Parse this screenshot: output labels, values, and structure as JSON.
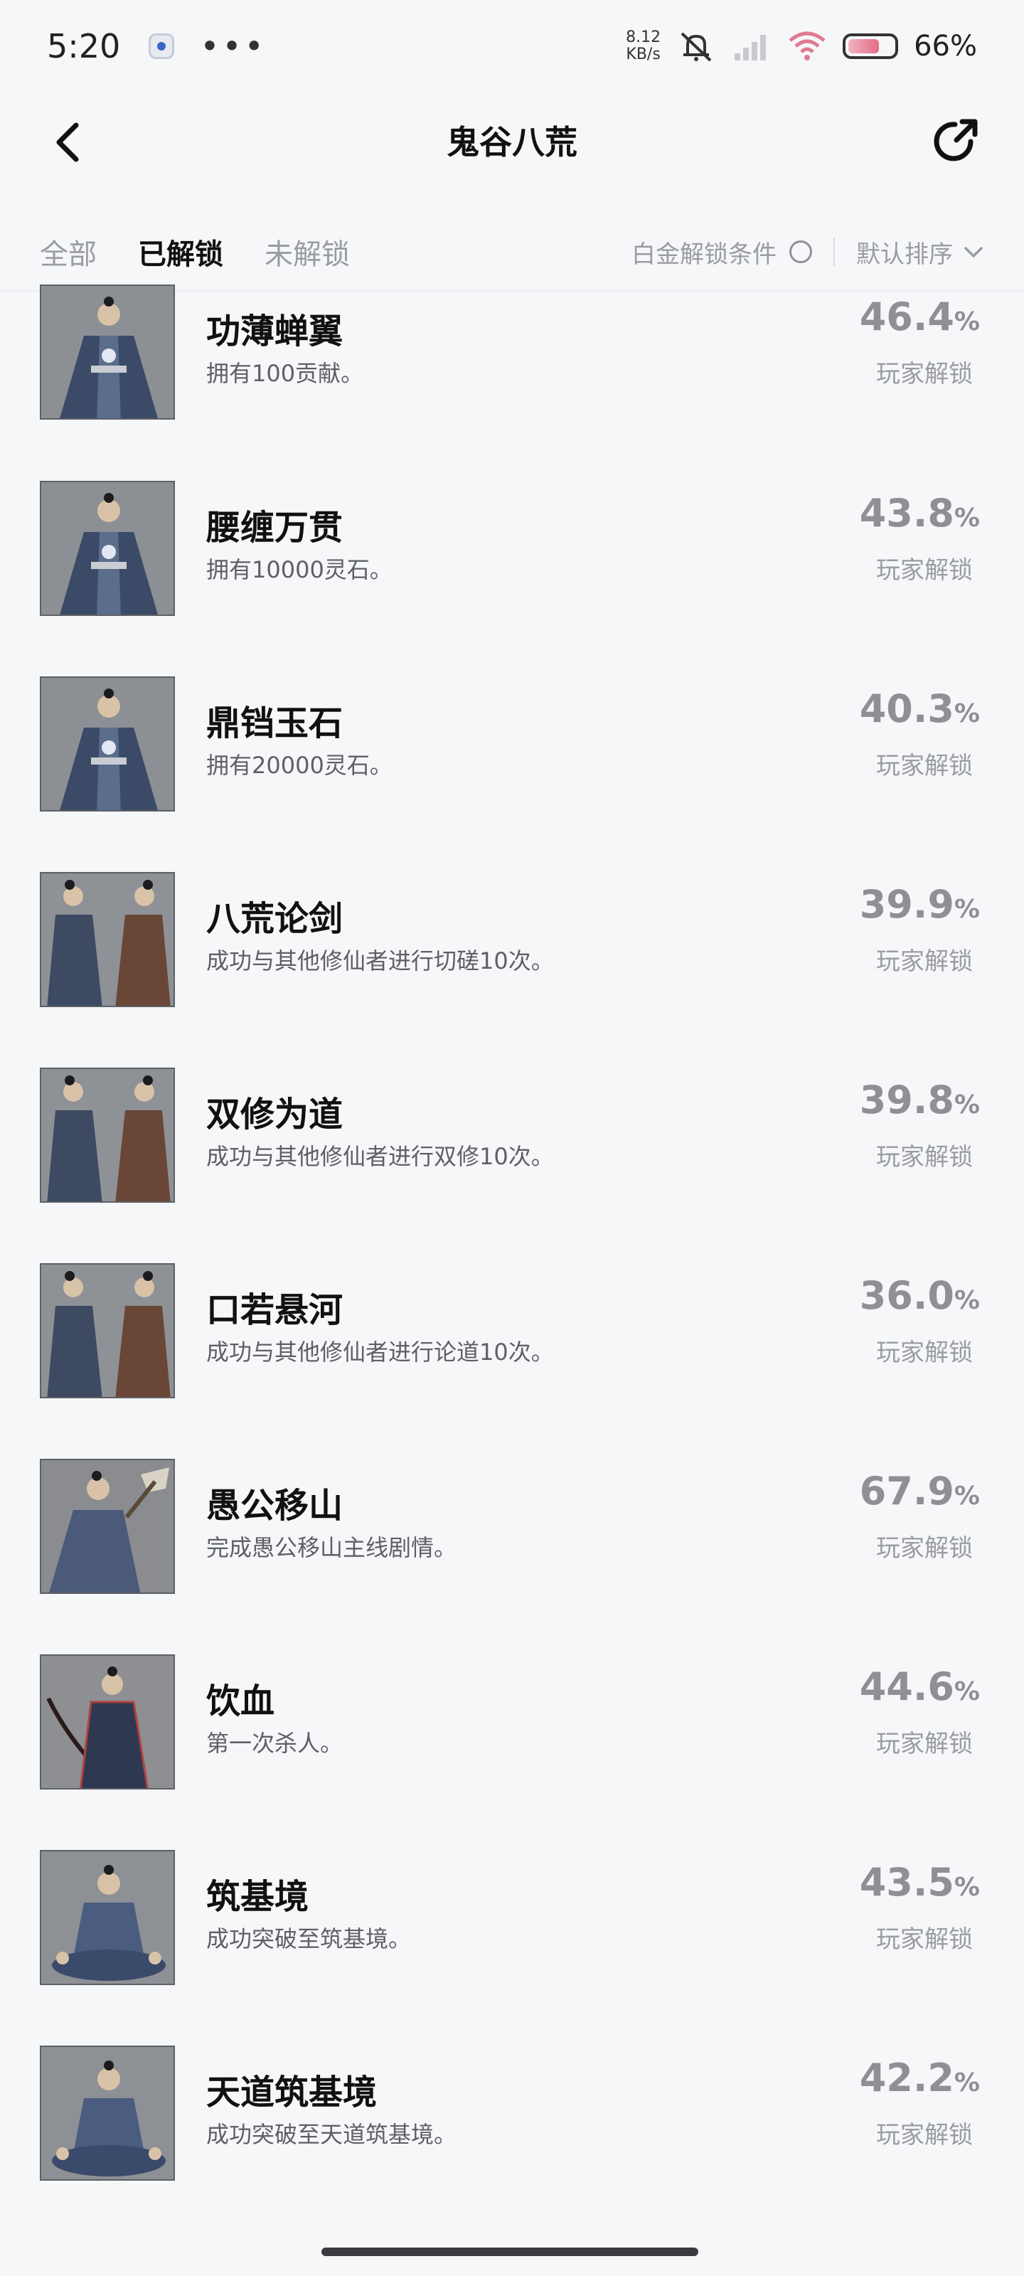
{
  "status_bar": {
    "time": "5:20",
    "dots": "•••",
    "net_speed_value": "8.12",
    "net_speed_unit": "KB/s",
    "battery": "66%"
  },
  "header": {
    "title": "鬼谷八荒"
  },
  "tabs": [
    {
      "label": "全部"
    },
    {
      "label": "已解锁"
    },
    {
      "label": "未解锁"
    }
  ],
  "filters": {
    "platinum": "白金解锁条件",
    "sort": "默认排序"
  },
  "achievements": [
    {
      "title": "功薄蝉翼",
      "desc": "拥有100贡献。",
      "rate": "46.4",
      "pct": "%",
      "unlock": "玩家解锁",
      "icon": "robed-figure-icon"
    },
    {
      "title": "腰缠万贯",
      "desc": "拥有10000灵石。",
      "rate": "43.8",
      "pct": "%",
      "unlock": "玩家解锁",
      "icon": "robed-figure-icon"
    },
    {
      "title": "鼎铛玉石",
      "desc": "拥有20000灵石。",
      "rate": "40.3",
      "pct": "%",
      "unlock": "玩家解锁",
      "icon": "robed-figure-icon"
    },
    {
      "title": "八荒论剑",
      "desc": "成功与其他修仙者进行切磋10次。",
      "rate": "39.9",
      "pct": "%",
      "unlock": "玩家解锁",
      "icon": "two-figures-icon"
    },
    {
      "title": "双修为道",
      "desc": "成功与其他修仙者进行双修10次。",
      "rate": "39.8",
      "pct": "%",
      "unlock": "玩家解锁",
      "icon": "two-figures-icon"
    },
    {
      "title": "口若悬河",
      "desc": "成功与其他修仙者进行论道10次。",
      "rate": "36.0",
      "pct": "%",
      "unlock": "玩家解锁",
      "icon": "two-figures-icon"
    },
    {
      "title": "愚公移山",
      "desc": "完成愚公移山主线剧情。",
      "rate": "67.9",
      "pct": "%",
      "unlock": "玩家解锁",
      "icon": "figure-with-hoe-icon"
    },
    {
      "title": "饮血",
      "desc": "第一次杀人。",
      "rate": "44.6",
      "pct": "%",
      "unlock": "玩家解锁",
      "icon": "swordsman-icon"
    },
    {
      "title": "筑基境",
      "desc": "成功突破至筑基境。",
      "rate": "43.5",
      "pct": "%",
      "unlock": "玩家解锁",
      "icon": "meditating-figure-icon"
    },
    {
      "title": "天道筑基境",
      "desc": "成功突破至天道筑基境。",
      "rate": "42.2",
      "pct": "%",
      "unlock": "玩家解锁",
      "icon": "meditating-figure-icon"
    }
  ]
}
